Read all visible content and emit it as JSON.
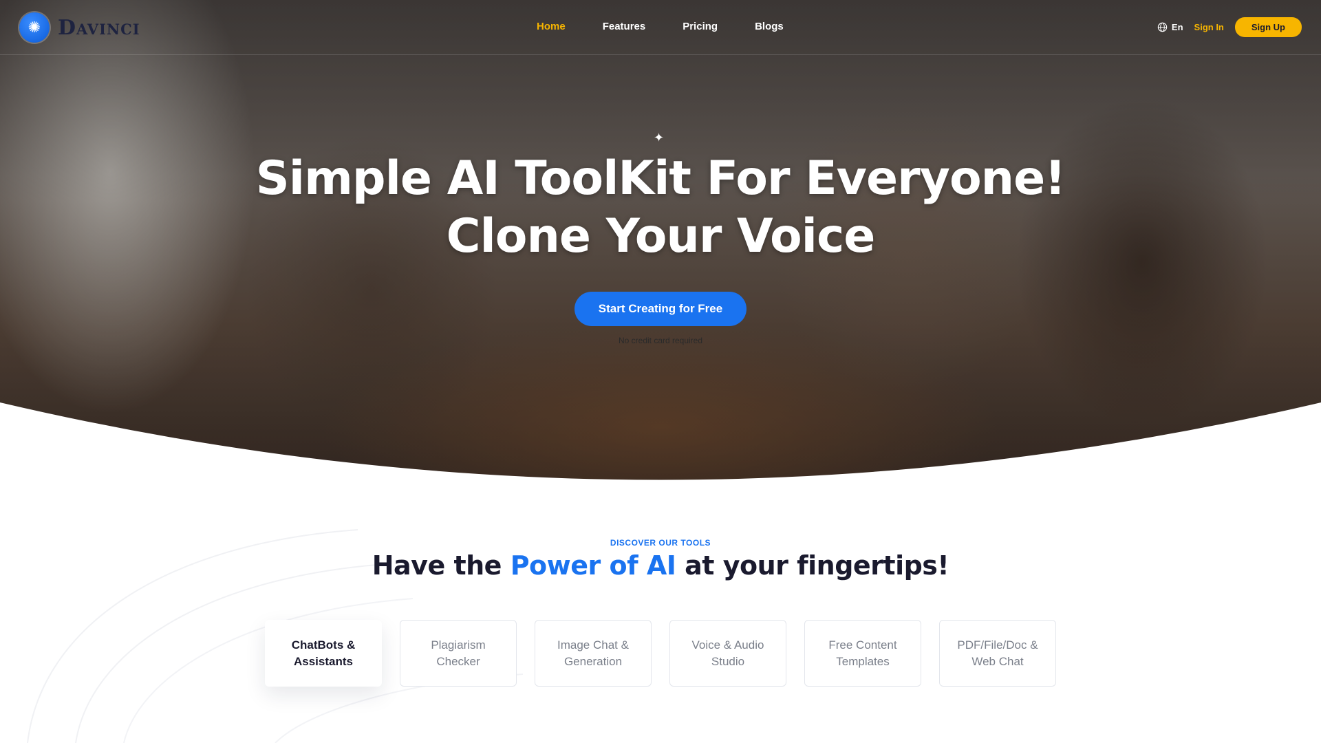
{
  "brand": {
    "name": "Davinci",
    "logo_icon": "brain-icon"
  },
  "nav": {
    "links": [
      {
        "label": "Home",
        "active": true
      },
      {
        "label": "Features",
        "active": false
      },
      {
        "label": "Pricing",
        "active": false
      },
      {
        "label": "Blogs",
        "active": false
      }
    ],
    "language": "En",
    "signin_label": "Sign In",
    "signup_label": "Sign Up"
  },
  "hero": {
    "title_line1": "Simple AI ToolKit For Everyone!",
    "title_line2": "Clone Your Voice",
    "cta_label": "Start Creating for Free",
    "cta_note": "No credit card required"
  },
  "tools": {
    "eyebrow": "DISCOVER OUR TOOLS",
    "heading_prefix": "Have the",
    "heading_accent": "Power of AI",
    "heading_suffix": "at your fingertips!",
    "tabs": [
      {
        "label": "ChatBots & Assistants",
        "active": true
      },
      {
        "label": "Plagiarism Checker",
        "active": false
      },
      {
        "label": "Image Chat & Generation",
        "active": false
      },
      {
        "label": "Voice & Audio Studio",
        "active": false
      },
      {
        "label": "Free Content Templates",
        "active": false
      },
      {
        "label": "PDF/File/Doc & Web Chat",
        "active": false
      }
    ]
  },
  "colors": {
    "accent_blue": "#1a73f0",
    "accent_yellow": "#f7b500",
    "heading_dark": "#1a1a2e"
  }
}
